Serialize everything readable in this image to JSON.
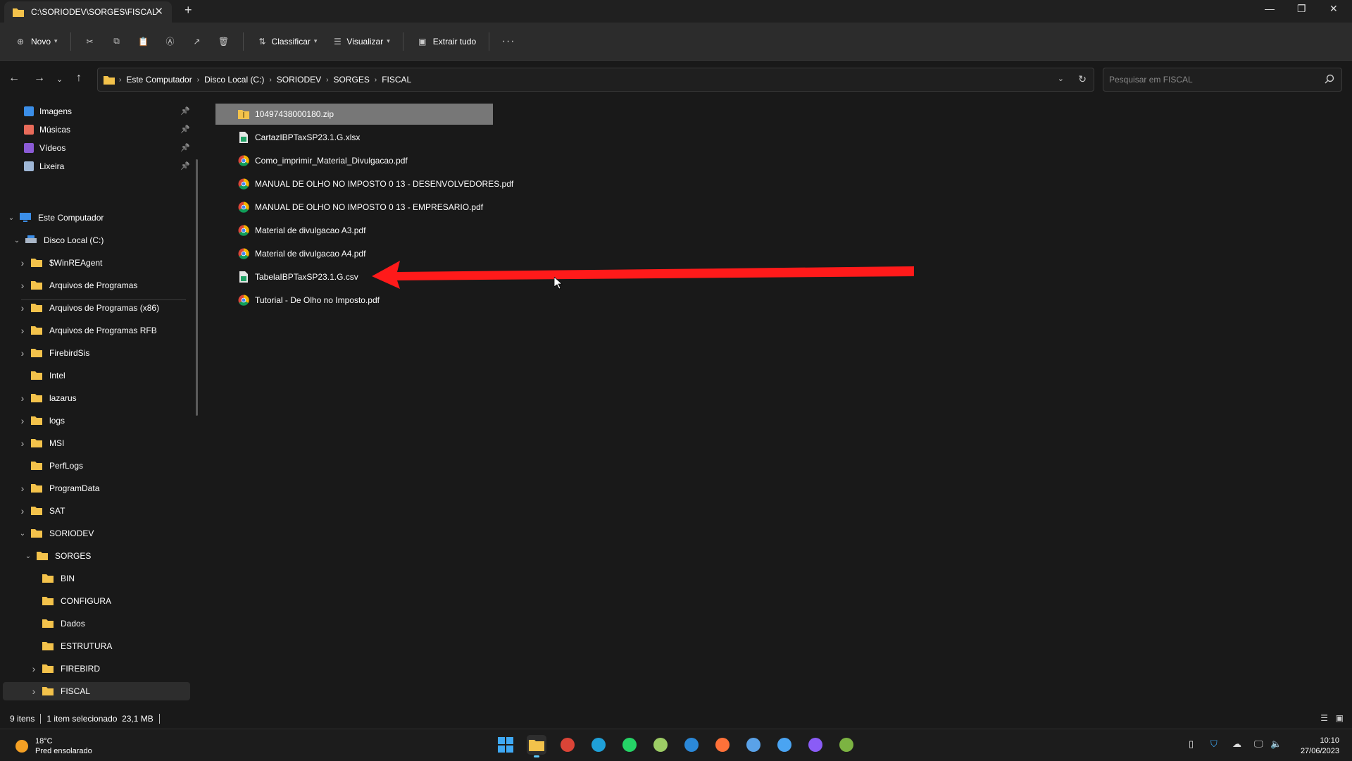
{
  "window": {
    "tab_title": "C:\\SORIODEV\\SORGES\\FISCAL",
    "controls": [
      "minimize",
      "restore",
      "close"
    ]
  },
  "toolbar": {
    "new_label": "Novo",
    "sort_label": "Classificar",
    "view_label": "Visualizar",
    "extract_label": "Extrair tudo"
  },
  "address": {
    "breadcrumbs": [
      "Este Computador",
      "Disco Local (C:)",
      "SORIODEV",
      "SORGES",
      "FISCAL"
    ]
  },
  "search": {
    "placeholder": "Pesquisar em FISCAL"
  },
  "sidebar": {
    "quick_access": [
      {
        "label": "Imagens",
        "icon": "images-icon",
        "color": "#3b8ee8"
      },
      {
        "label": "Músicas",
        "icon": "music-icon",
        "color": "#e86b5a"
      },
      {
        "label": "Vídeos",
        "icon": "videos-icon",
        "color": "#8b5bd6"
      },
      {
        "label": "Lixeira",
        "icon": "recycle-bin-icon",
        "color": "#9fb7d6"
      }
    ],
    "tree": [
      {
        "label": "Este Computador",
        "level": 0,
        "expanded": true,
        "icon": "computer-icon"
      },
      {
        "label": "Disco Local (C:)",
        "level": 1,
        "expanded": true,
        "icon": "drive-icon"
      },
      {
        "label": "$WinREAgent",
        "level": 2,
        "has_children": true
      },
      {
        "label": "Arquivos de Programas",
        "level": 2,
        "has_children": true
      },
      {
        "label": "Arquivos de Programas (x86)",
        "level": 2,
        "has_children": true
      },
      {
        "label": "Arquivos de Programas RFB",
        "level": 2,
        "has_children": true
      },
      {
        "label": "FirebirdSis",
        "level": 2,
        "has_children": true
      },
      {
        "label": "Intel",
        "level": 2,
        "has_children": false
      },
      {
        "label": "lazarus",
        "level": 2,
        "has_children": true
      },
      {
        "label": "logs",
        "level": 2,
        "has_children": true
      },
      {
        "label": "MSI",
        "level": 2,
        "has_children": true
      },
      {
        "label": "PerfLogs",
        "level": 2,
        "has_children": false
      },
      {
        "label": "ProgramData",
        "level": 2,
        "has_children": true
      },
      {
        "label": "SAT",
        "level": 2,
        "has_children": true
      },
      {
        "label": "SORIODEV",
        "level": 2,
        "expanded": true
      },
      {
        "label": "SORGES",
        "level": 3,
        "expanded": true
      },
      {
        "label": "BIN",
        "level": 4,
        "has_children": false
      },
      {
        "label": "CONFIGURA",
        "level": 4,
        "has_children": false
      },
      {
        "label": "Dados",
        "level": 4,
        "has_children": false
      },
      {
        "label": "ESTRUTURA",
        "level": 4,
        "has_children": false
      },
      {
        "label": "FIREBIRD",
        "level": 4,
        "has_children": true
      },
      {
        "label": "FISCAL",
        "level": 4,
        "has_children": true,
        "selected": true
      }
    ]
  },
  "files": [
    {
      "name": "10497438000180.zip",
      "type": "zip",
      "selected": true
    },
    {
      "name": "CartazIBPTaxSP23.1.G.xlsx",
      "type": "xlsx"
    },
    {
      "name": "Como_imprimir_Material_Divulgacao.pdf",
      "type": "pdf"
    },
    {
      "name": "MANUAL DE OLHO NO IMPOSTO 0 13 - DESENVOLVEDORES.pdf",
      "type": "pdf"
    },
    {
      "name": "MANUAL DE OLHO NO IMPOSTO 0 13 - EMPRESARIO.pdf",
      "type": "pdf"
    },
    {
      "name": "Material de divulgacao A3.pdf",
      "type": "pdf"
    },
    {
      "name": "Material de divulgacao A4.pdf",
      "type": "pdf"
    },
    {
      "name": "TabelaIBPTaxSP23.1.G.csv",
      "type": "csv"
    },
    {
      "name": "Tutorial - De Olho no Imposto.pdf",
      "type": "pdf"
    }
  ],
  "status": {
    "items": "9 itens",
    "selection": "1 item selecionado  23,1 MB"
  },
  "taskbar": {
    "temperature": "18°C",
    "weather": "Pred ensolarado",
    "time": "10:10",
    "date": "27/06/2023",
    "apps": [
      "start-icon",
      "file-explorer-icon",
      "chrome-icon",
      "edge-icon",
      "whatsapp-icon",
      "spreadsheet-app-icon",
      "mail-app-icon",
      "firefox-icon",
      "settings-app-icon",
      "notepad-icon",
      "video-app-icon",
      "sorges-app-icon"
    ]
  },
  "colors": {
    "accent": "#60cdff",
    "folder": "#f3c24b",
    "arrow": "#ff1a1a"
  }
}
